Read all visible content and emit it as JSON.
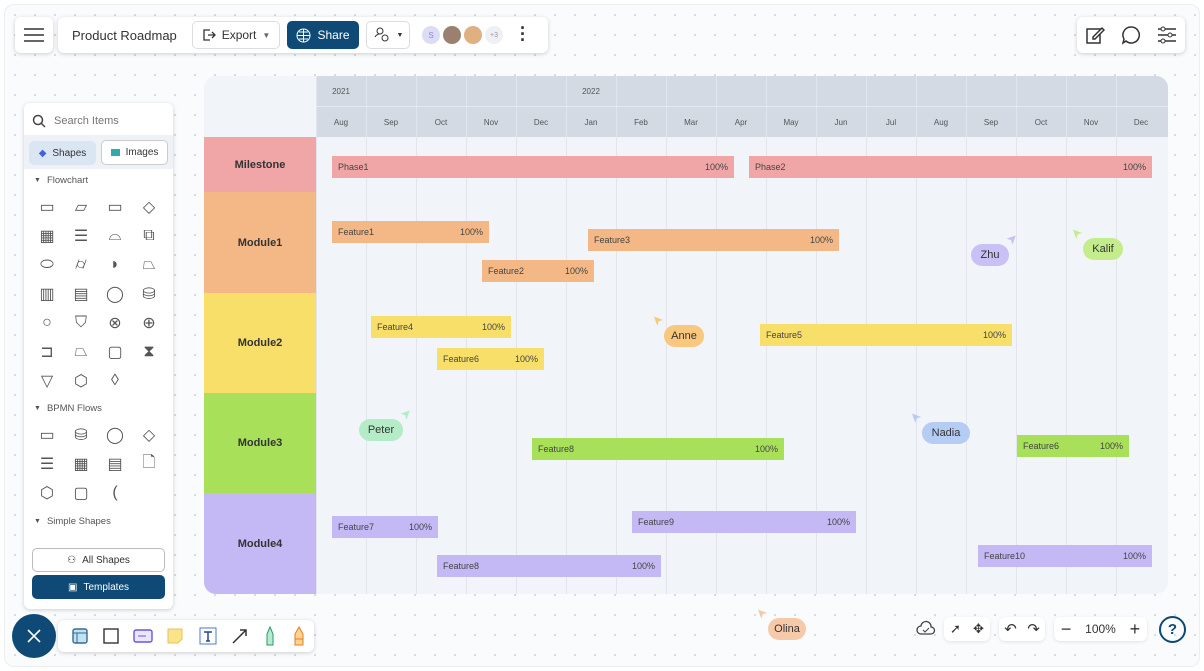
{
  "toolbar": {
    "title": "Product Roadmap",
    "export": "Export",
    "share": "Share",
    "avatar_initial": "S",
    "avatar_more": "+3"
  },
  "sidebar": {
    "search_placeholder": "Search Items",
    "tabs": [
      "Shapes",
      "Images"
    ],
    "sections": [
      "Flowchart",
      "BPMN Flows",
      "Simple Shapes"
    ],
    "all_shapes": "All Shapes",
    "templates": "Templates"
  },
  "gantt": {
    "years": [
      {
        "label": "2021",
        "col": 0
      },
      {
        "label": "2022",
        "col": 5
      }
    ],
    "months": [
      "Aug",
      "Sep",
      "Oct",
      "Nov",
      "Dec",
      "Jan",
      "Feb",
      "Mar",
      "Apr",
      "May",
      "Jun",
      "Jul",
      "Aug",
      "Sep",
      "Oct",
      "Nov",
      "Dec"
    ],
    "rows": [
      {
        "label": "Milestone",
        "color": "#f0a6a6"
      },
      {
        "label": "Module1",
        "color": "#f4b886"
      },
      {
        "label": "Module2",
        "color": "#f7df6a"
      },
      {
        "label": "Module3",
        "color": "#a8e05a"
      },
      {
        "label": "Module4",
        "color": "#c4b8f5"
      }
    ],
    "bars": [
      {
        "label": "Phase1",
        "pct": "100%",
        "row": 0
      },
      {
        "label": "Phase2",
        "pct": "100%",
        "row": 0
      },
      {
        "label": "Feature1",
        "pct": "100%",
        "row": 1
      },
      {
        "label": "Feature3",
        "pct": "100%",
        "row": 1
      },
      {
        "label": "Feature2",
        "pct": "100%",
        "row": 1
      },
      {
        "label": "Feature4",
        "pct": "100%",
        "row": 2
      },
      {
        "label": "Feature6",
        "pct": "100%",
        "row": 2
      },
      {
        "label": "Feature5",
        "pct": "100%",
        "row": 2
      },
      {
        "label": "Feature8",
        "pct": "100%",
        "row": 3
      },
      {
        "label": "Feature6",
        "pct": "100%",
        "row": 3
      },
      {
        "label": "Feature7",
        "pct": "100%",
        "row": 4
      },
      {
        "label": "Feature9",
        "pct": "100%",
        "row": 4
      },
      {
        "label": "Feature8",
        "pct": "100%",
        "row": 4
      },
      {
        "label": "Feature10",
        "pct": "100%",
        "row": 4
      }
    ]
  },
  "cursors": [
    {
      "name": "Zhu",
      "color": "#c9c1f5"
    },
    {
      "name": "Kalif",
      "color": "#c5ec8c"
    },
    {
      "name": "Anne",
      "color": "#f9c77e"
    },
    {
      "name": "Peter",
      "color": "#b4ecc8"
    },
    {
      "name": "Nadia",
      "color": "#b5ccf5"
    },
    {
      "name": "Olina",
      "color": "#f6c9a8"
    }
  ],
  "bottom": {
    "zoom": "100%",
    "help": "?"
  }
}
